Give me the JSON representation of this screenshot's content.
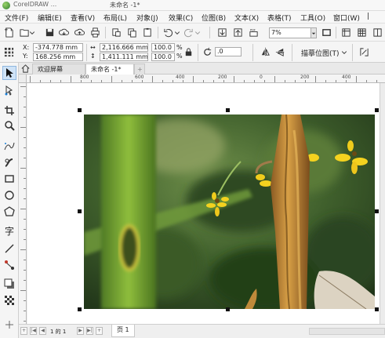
{
  "window": {
    "app_title": "CorelDRAW ...",
    "doc_title": "未命名 -1*"
  },
  "menu": [
    "文件(F)",
    "编辑(E)",
    "查看(V)",
    "布局(L)",
    "对象(J)",
    "效果(C)",
    "位图(B)",
    "文本(X)",
    "表格(T)",
    "工具(O)",
    "窗口(W)"
  ],
  "standard_toolbar": {
    "zoom_value": "7%"
  },
  "property_bar": {
    "x_label": "X:",
    "x_value": "-374.778 mm",
    "y_label": "Y:",
    "y_value": "168.256 mm",
    "width_value": "2,116.666 mm",
    "height_value": "1,411.111 mm",
    "scale_x": "100.0",
    "scale_y": "100.0",
    "percent_sign": "%",
    "rotation_value": ".0",
    "trace_bitmap_label": "描摹位图(T)"
  },
  "tabs": {
    "welcome": "欢迎屏幕",
    "document": "未命名 -1*",
    "add": "+"
  },
  "ruler": {
    "h_labels": [
      "800",
      "600",
      "400",
      "200",
      "0",
      "200",
      "400",
      "600",
      "800"
    ]
  },
  "status": {
    "page_counter": "1 的 1",
    "page_tab": "页 1"
  },
  "colors": {
    "selection_handle": "#111111",
    "tab_active_bg": "#ffffff",
    "toolbar_bg": "#f5f5f5"
  }
}
